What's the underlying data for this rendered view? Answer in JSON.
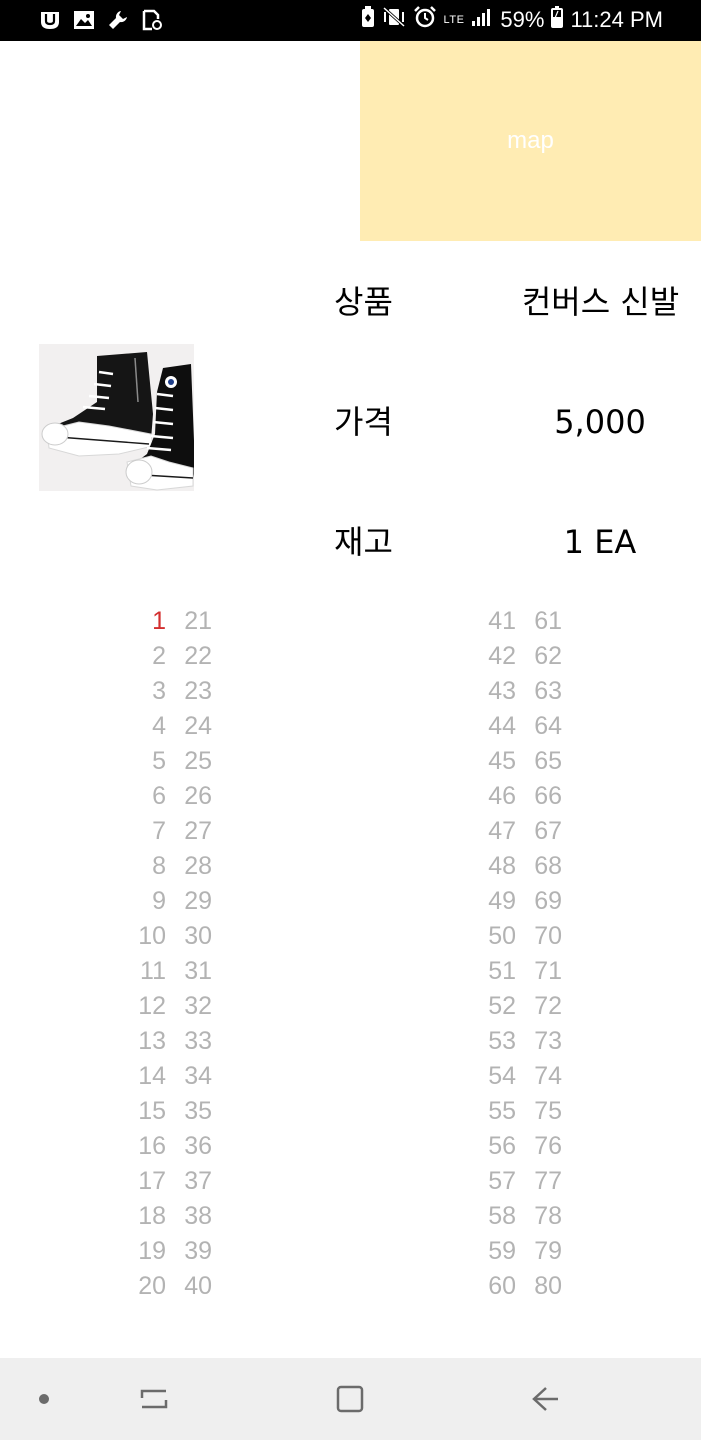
{
  "status_bar": {
    "battery": "59%",
    "time": "11:24 PM",
    "network": "LTE",
    "left_icons": [
      "u-logo-icon",
      "gallery-icon",
      "wrench-icon",
      "device-status-icon"
    ],
    "right_icons": [
      "battery-saver-icon",
      "vibrate-mute-icon",
      "alarm-icon",
      "lte-icon",
      "signal-icon",
      "battery-icon"
    ]
  },
  "map": {
    "label": "map",
    "background": "#ffecb3"
  },
  "product": {
    "image_icon": "sneaker-image",
    "rows": [
      {
        "label": "상품",
        "value": "컨버스 신발"
      },
      {
        "label": "가격",
        "value": "5,000"
      },
      {
        "label": "재고",
        "value": "1 EA"
      }
    ]
  },
  "number_lists": {
    "selected": "1",
    "selected_color": "#d32f2f",
    "text_color": "#b3b3b3",
    "column_1": [
      "1",
      "2",
      "3",
      "4",
      "5",
      "6",
      "7",
      "8",
      "9",
      "10",
      "11",
      "12",
      "13",
      "14",
      "15",
      "16",
      "17",
      "18",
      "19",
      "20"
    ],
    "column_2": [
      "21",
      "22",
      "23",
      "24",
      "25",
      "26",
      "27",
      "28",
      "29",
      "30",
      "31",
      "32",
      "33",
      "34",
      "35",
      "36",
      "37",
      "38",
      "39",
      "40"
    ],
    "column_3": [
      "41",
      "42",
      "43",
      "44",
      "45",
      "46",
      "47",
      "48",
      "49",
      "50",
      "51",
      "52",
      "53",
      "54",
      "55",
      "56",
      "57",
      "58",
      "59",
      "60"
    ],
    "column_4": [
      "61",
      "62",
      "63",
      "64",
      "65",
      "66",
      "67",
      "68",
      "69",
      "70",
      "71",
      "72",
      "73",
      "74",
      "75",
      "76",
      "77",
      "78",
      "79",
      "80"
    ]
  },
  "nav_bar": {
    "buttons": [
      "dot-icon",
      "recent-apps-icon",
      "home-icon",
      "back-icon"
    ]
  }
}
